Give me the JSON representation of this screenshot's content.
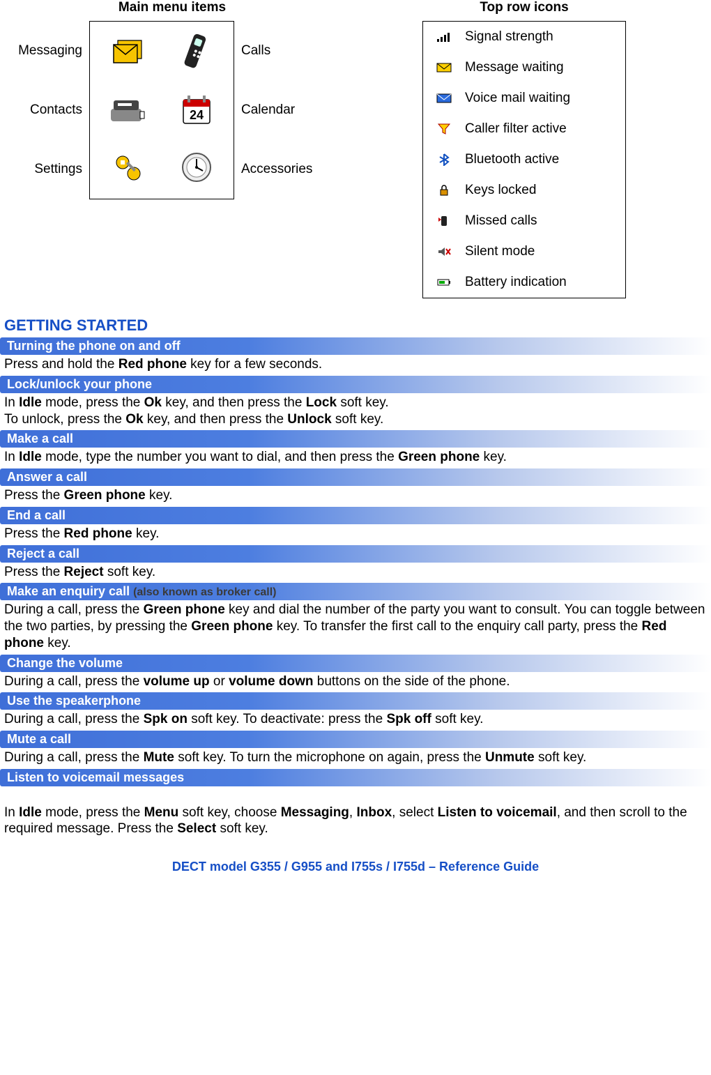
{
  "top": {
    "menu_heading": "Main menu items",
    "icons_heading": "Top row icons",
    "menu_left": [
      "Messaging",
      "Contacts",
      "Settings"
    ],
    "menu_right": [
      "Calls",
      "Calendar",
      "Accessories"
    ],
    "top_icons": [
      "Signal strength",
      "Message waiting",
      "Voice mail waiting",
      "Caller filter active",
      "Bluetooth active",
      "Keys locked",
      "Missed calls",
      "Silent mode",
      "Battery indication"
    ]
  },
  "section_title": "GETTING STARTED",
  "sections": [
    {
      "title": "Turning the phone on and off",
      "body_html": "Press and hold the <b>Red phone</b> key for a few seconds."
    },
    {
      "title": "Lock/unlock your phone",
      "body_html": "In <b>Idle</b> mode, press the <b>Ok</b> key, and then press the <b>Lock</b> soft key.<br>To unlock, press the <b>Ok</b> key, and then press the <b>Unlock</b> soft key."
    },
    {
      "title": "Make a call",
      "body_html": "In <b>Idle</b> mode, type the number you want to dial, and then press the <b>Green phone</b> key."
    },
    {
      "title": "Answer a call",
      "body_html": "Press the <b>Green phone</b> key."
    },
    {
      "title": "End a call",
      "body_html": "Press the <b>Red phone</b> key."
    },
    {
      "title": "Reject a call",
      "body_html": "Press the <b>Reject</b> soft key."
    },
    {
      "title": "Make an enquiry call",
      "subtitle": "(also known as broker call)",
      "body_html": "During a call, press the <b>Green phone</b> key and dial the number of the party you want to consult. You can toggle between the two parties, by pressing the <b>Green phone</b> key. To transfer the first call to the enquiry call party, press the <b>Red phone</b> key."
    },
    {
      "title": "Change the volume",
      "body_html": "During a call, press the <b>volume up</b> or <b>volume down</b> buttons on the side of the phone."
    },
    {
      "title": "Use the speakerphone",
      "body_html": "During a call, press the <b>Spk on</b> soft key. To deactivate: press the <b>Spk off</b> soft key."
    },
    {
      "title": "Mute a call",
      "body_html": "During a call, press the <b>Mute</b> soft key. To turn the microphone on again, press the <b>Unmute</b> soft key."
    },
    {
      "title": "Listen to voicemail messages",
      "body_html": "<br>In <b>Idle</b> mode, press the <b>Menu</b> soft key, choose <b>Messaging</b>, <b>Inbox</b>, select <b>Listen to voicemail</b>, and then scroll to the required message. Press the <b>Select</b> soft key."
    }
  ],
  "footer": "DECT model G355 / G955 and I755s / I755d – Reference Guide"
}
